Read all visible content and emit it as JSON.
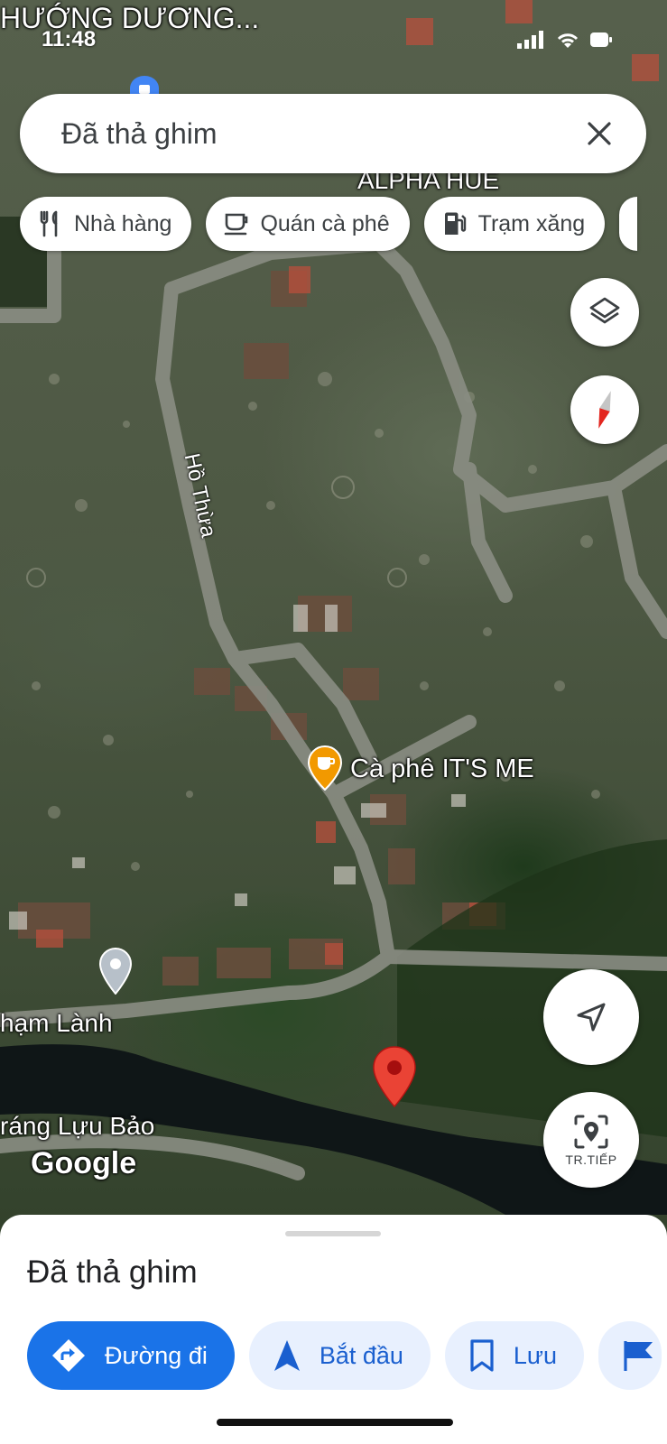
{
  "status": {
    "time": "11:48"
  },
  "search": {
    "value": "Đã thả ghim"
  },
  "chips": [
    {
      "label": "Nhà hàng",
      "icon": "fork-knife-icon"
    },
    {
      "label": "Quán cà phê",
      "icon": "coffee-cup-icon"
    },
    {
      "label": "Trạm xăng",
      "icon": "gas-pump-icon"
    }
  ],
  "map": {
    "labels": {
      "top_area": "HƯỚNG DƯƠNG...",
      "alpha": "ALPHA HUE",
      "street": "Hồ Thừa",
      "cafe": "Cà phê IT'S ME",
      "pham_lanh": "hạm Lành",
      "trang_luu_bao": "ráng Lựu Bảo",
      "google": "Google"
    }
  },
  "map_buttons": {
    "live_view_label": "TR.TIẾP"
  },
  "sheet": {
    "title": "Đã thả ghim",
    "actions": {
      "directions": "Đường đi",
      "start": "Bắt đầu",
      "save": "Lưu"
    }
  },
  "colors": {
    "accent": "#1a73e8",
    "pin_red": "#ea4335",
    "cafe_orange": "#f29900"
  }
}
